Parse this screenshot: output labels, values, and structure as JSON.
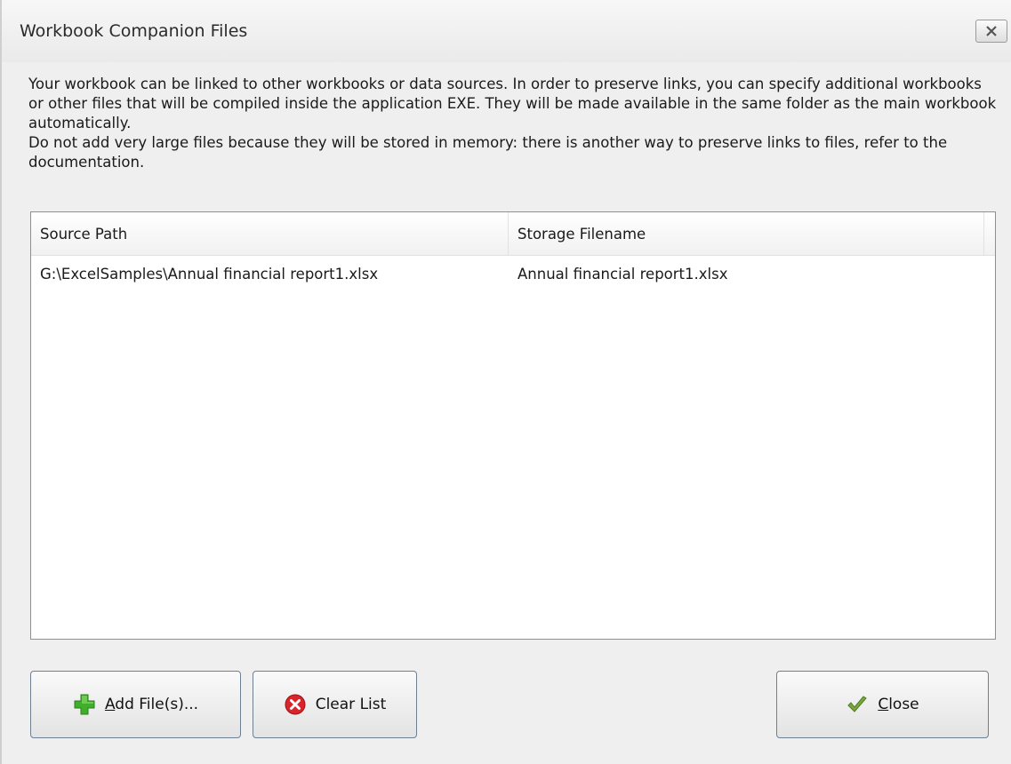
{
  "window": {
    "title": "Workbook Companion Files"
  },
  "description": {
    "lines": [
      "Your workbook can be linked to other workbooks or data sources. In order to preserve links, you can specify additional workbooks or other files that will be compiled inside the application EXE. They will be made available in the same folder as the main workbook automatically.",
      "Do not add very large files because they will be stored in memory: there is another way to preserve links to files, refer to the documentation."
    ]
  },
  "table": {
    "columns": [
      "Source Path",
      "Storage Filename"
    ],
    "rows": [
      {
        "source_path": "G:\\ExcelSamples\\Annual financial report1.xlsx",
        "storage_filename": "Annual financial report1.xlsx"
      }
    ]
  },
  "buttons": {
    "add_files": {
      "label_underlined": "A",
      "label_rest": "dd File(s)...",
      "icon": "add-plus-icon"
    },
    "clear_list": {
      "label": "Clear List",
      "icon": "clear-x-circle-icon"
    },
    "close": {
      "label_underlined": "C",
      "label_rest": "lose",
      "icon": "checkmark-icon"
    }
  },
  "colors": {
    "add_icon": "#3fae2a",
    "clear_icon": "#d8242a",
    "check_icon": "#78a83c"
  }
}
